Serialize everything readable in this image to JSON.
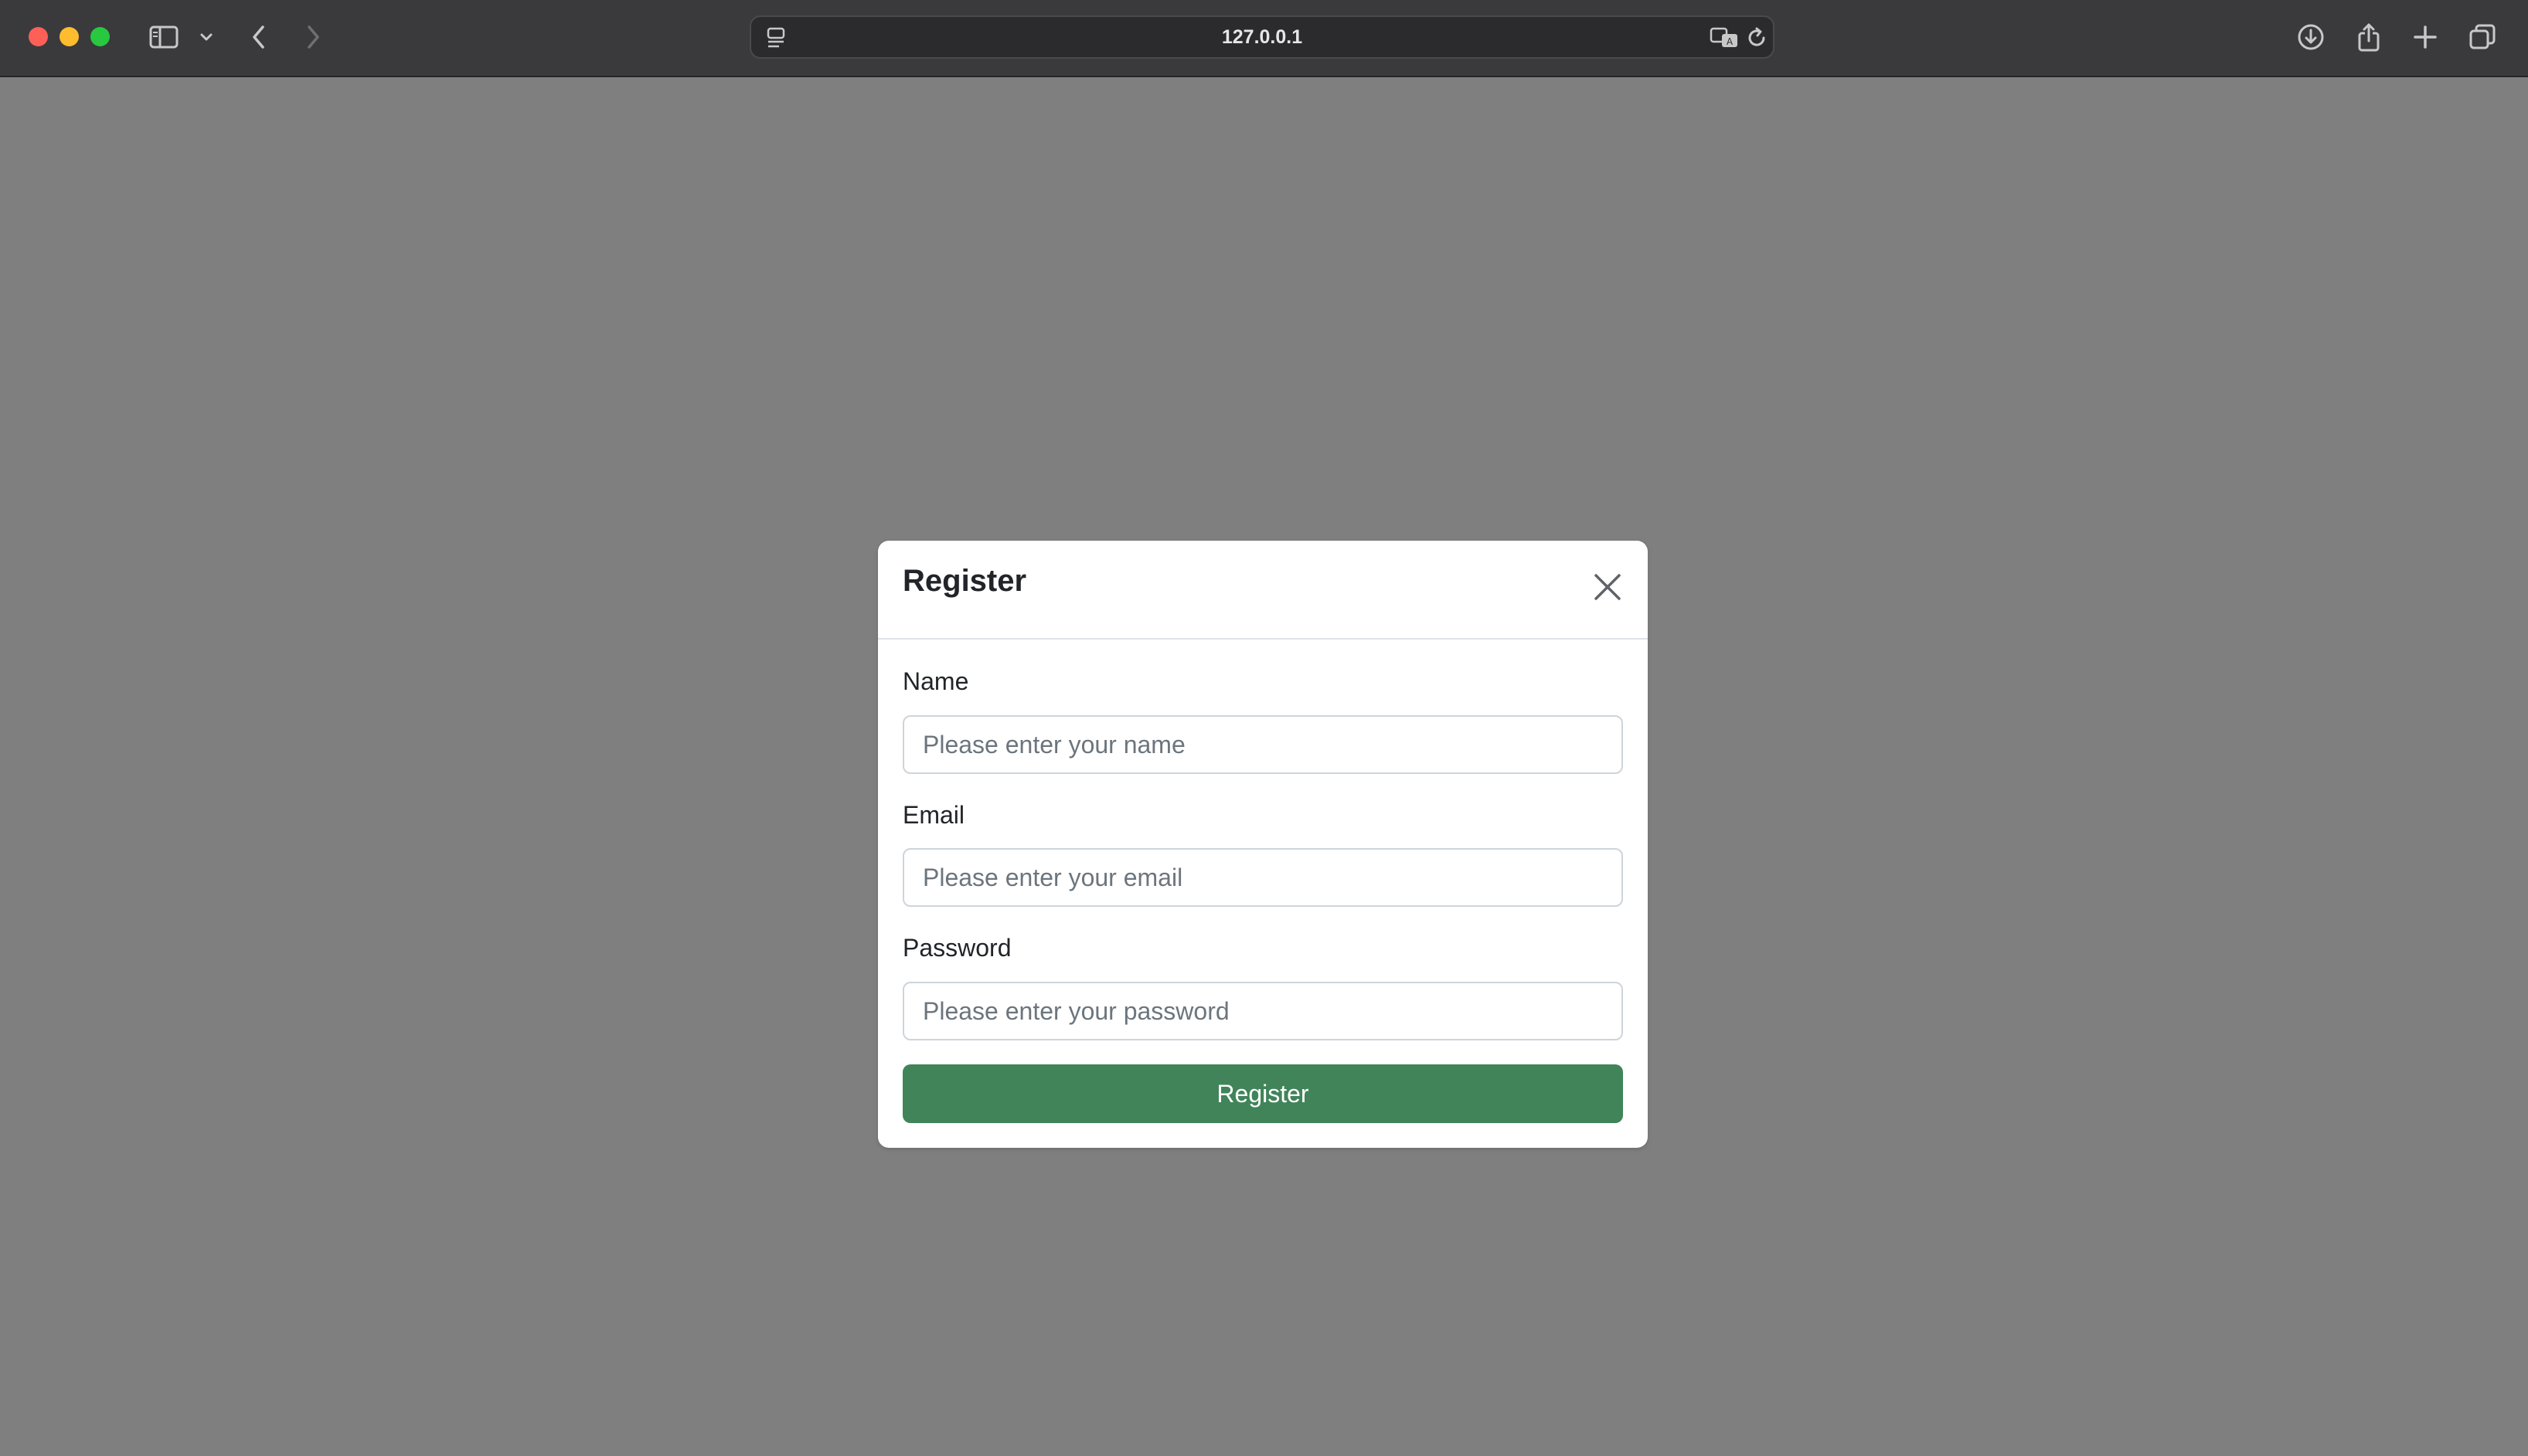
{
  "browser": {
    "url": "127.0.0.1",
    "icons": {
      "sidebar": "sidebar-toggle-icon",
      "sidebar_menu": "chevron-down-icon",
      "back": "back-arrow-icon",
      "forward": "forward-arrow-icon",
      "page_menu": "page-menu-icon",
      "translate": "translate-icon",
      "reload": "reload-icon",
      "downloads": "download-icon",
      "share": "share-icon",
      "new_tab": "plus-icon",
      "tab_overview": "tabs-icon"
    }
  },
  "modal": {
    "title": "Register",
    "close_icon": "close-icon",
    "fields": [
      {
        "label": "Name",
        "placeholder": "Please enter your name",
        "value": ""
      },
      {
        "label": "Email",
        "placeholder": "Please enter your email",
        "value": ""
      },
      {
        "label": "Password",
        "placeholder": "Please enter your password",
        "value": ""
      }
    ],
    "submit_label": "Register"
  },
  "colors": {
    "overlay": "#7f7f7f",
    "submit_button": "#41845a",
    "toolbar": "#3a3a3c"
  }
}
